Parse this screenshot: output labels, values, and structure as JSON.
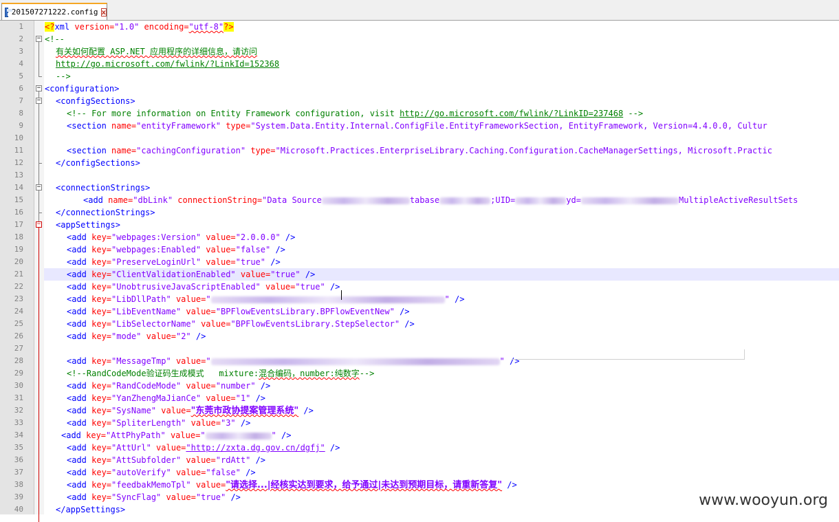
{
  "tab": {
    "label": "201507271222.config",
    "close": "x"
  },
  "watermark": "www.wooyun.org",
  "lines": [
    {
      "n": "1"
    },
    {
      "n": "2"
    },
    {
      "n": "3"
    },
    {
      "n": "4"
    },
    {
      "n": "5"
    },
    {
      "n": "6"
    },
    {
      "n": "7"
    },
    {
      "n": "8"
    },
    {
      "n": "9"
    },
    {
      "n": "10"
    },
    {
      "n": "11"
    },
    {
      "n": "12"
    },
    {
      "n": "13"
    },
    {
      "n": "14"
    },
    {
      "n": "15"
    },
    {
      "n": "16"
    },
    {
      "n": "17"
    },
    {
      "n": "18"
    },
    {
      "n": "19"
    },
    {
      "n": "20"
    },
    {
      "n": "21"
    },
    {
      "n": "22"
    },
    {
      "n": "23"
    },
    {
      "n": "24"
    },
    {
      "n": "25"
    },
    {
      "n": "26"
    },
    {
      "n": "27"
    },
    {
      "n": "28"
    },
    {
      "n": "29"
    },
    {
      "n": "30"
    },
    {
      "n": "31"
    },
    {
      "n": "32"
    },
    {
      "n": "33"
    },
    {
      "n": "34"
    },
    {
      "n": "35"
    },
    {
      "n": "36"
    },
    {
      "n": "37"
    },
    {
      "n": "38"
    },
    {
      "n": "39"
    },
    {
      "n": "40"
    }
  ],
  "code": {
    "l1": {
      "pi_open": "<?",
      "tag": "xml",
      "a1": " version=",
      "v1": "\"1.0\"",
      "a2": " encoding=",
      "v2": "\"utf-8\"",
      "pi_close": "?>"
    },
    "l2": "<!--",
    "l3": "有关如何配置 ASP.NET 应用程序的详细信息，请访问",
    "l4": "http://go.microsoft.com/fwlink/?LinkId=152368",
    "l5": "-->",
    "l6": "<configuration>",
    "l7": "<configSections>",
    "l8": {
      "c1": "<!-- For more information on Entity Framework configuration, visit ",
      "link": "http://go.microsoft.com/fwlink/?LinkID=237468",
      "c2": " -->"
    },
    "l9": {
      "t": "<section",
      "a1": " name=",
      "v1": "\"entityFramework\"",
      "a2": " type=",
      "v2": "\"System.Data.Entity.Internal.ConfigFile.EntityFrameworkSection, EntityFramework, Version=4.4.0.0, Cultur"
    },
    "l11": {
      "t": "<section",
      "a1": " name=",
      "v1": "\"cachingConfiguration\"",
      "a2": " type=",
      "v2": "\"Microsoft.Practices.EnterpriseLibrary.Caching.Configuration.CacheManagerSettings, Microsoft.Practic"
    },
    "l12": "</configSections>",
    "l14": "<connectionStrings>",
    "l15": {
      "t": "<add",
      "a1": " name=",
      "v1": "\"dbLink\"",
      "a2": " connectionString=",
      "v2a": "\"Data Source",
      "v2b": "tabase",
      "v2c": ";UID=",
      "v2d": "yd=",
      "v2e": "MultipleActiveResultSets"
    },
    "l16": "</connectionStrings>",
    "l17": "<appSettings>",
    "l18": {
      "k": "\"webpages:Version\"",
      "v": "\"2.0.0.0\""
    },
    "l19": {
      "k": "\"webpages:Enabled\"",
      "v": "\"false\""
    },
    "l20": {
      "k": "\"PreserveLoginUrl\"",
      "v": "\"true\""
    },
    "l21": {
      "k": "\"ClientValidationEnabled\"",
      "v": "\"true\""
    },
    "l22": {
      "k": "\"UnobtrusiveJavaScriptEnabled\"",
      "v": "\"true\""
    },
    "l23": {
      "k": "\"LibDllPath\"",
      "v": "\""
    },
    "l24": {
      "k": "\"LibEventName\"",
      "v": "\"BPFlowEventsLibrary.BPFlowEventNew\""
    },
    "l25": {
      "k": "\"LibSelectorName\"",
      "v": "\"BPFlowEventsLibrary.StepSelector\""
    },
    "l26": {
      "k": "\"mode\"",
      "v": "\"2\""
    },
    "l28": {
      "k": "\"MessageTmp\"",
      "v": "\""
    },
    "l29": {
      "c1": "<!--RandCodeMode",
      "c2": "验证码生成模式",
      "c3": "   mixture:",
      "c4": "混合编码",
      "c5": "，number:",
      "c6": "纯数字",
      "c7": "-->"
    },
    "l30": {
      "k": "\"RandCodeMode\"",
      "v": "\"number\""
    },
    "l31": {
      "k": "\"YanZhengMaJianCe\"",
      "v": "\"1\""
    },
    "l32": {
      "k": "\"SysName\"",
      "v": "\"东莞市政协提案管理系统\""
    },
    "l33": {
      "k": "\"SpliterLength\"",
      "v": "\"3\""
    },
    "l34": {
      "k": "\"AttPhyPath\"",
      "v": "\""
    },
    "l35": {
      "k": "\"AttUrl\"",
      "v": "\"http://zxta.dg.gov.cn/dgfj\""
    },
    "l36": {
      "k": "\"AttSubfolder\"",
      "v": "\"rdAtt\""
    },
    "l37": {
      "k": "\"autoVerify\"",
      "v": "\"false\""
    },
    "l38": {
      "k": "\"feedbakMemoTpl\"",
      "v": "\"请选择...|经核实达到要求，给予通过|未达到预期目标，请重新答复\""
    },
    "l39": {
      "k": "\"SyncFlag\"",
      "v": "\"true\""
    },
    "l40": "</appSettings>",
    "add": "<add",
    "key": " key=",
    "value": " value=",
    "close": " />"
  }
}
